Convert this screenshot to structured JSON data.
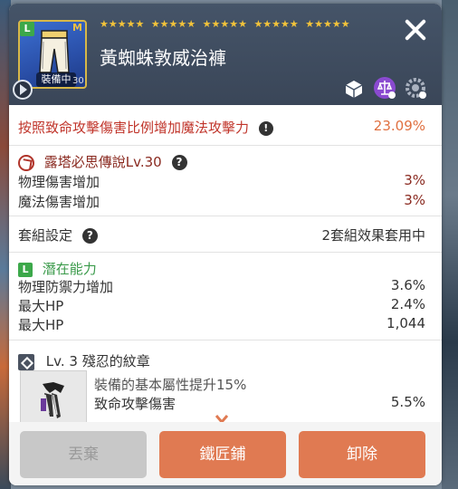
{
  "item": {
    "rank_badge": "L",
    "m_badge": "M",
    "equipped_label": "裝備中",
    "level": "30",
    "name": "黃蜘蛛敦威治褲",
    "star_groups": [
      "★★★★★",
      "★★★★★",
      "★★★★★",
      "★★★★★",
      "★★★★★"
    ]
  },
  "effect": {
    "label": "按照致命攻擊傷害比例增加魔法攻擊力",
    "value": "23.09%"
  },
  "set_item": {
    "title": "露塔必思傳說Lv.30",
    "stats": [
      {
        "label": "物理傷害增加",
        "value": "3%"
      },
      {
        "label": "魔法傷害增加",
        "value": "3%"
      }
    ]
  },
  "set_config": {
    "label": "套組設定",
    "value": "2套組效果套用中"
  },
  "potential": {
    "badge": "L",
    "title": "潛在能力",
    "stats": [
      {
        "label": "物理防禦力增加",
        "value": "3.6%"
      },
      {
        "label": "最大HP",
        "value": "2.4%"
      },
      {
        "label": "最大HP",
        "value": "1,044"
      }
    ]
  },
  "emblem": {
    "title": "Lv. 3 殘忍的紋章",
    "desc": "裝備的基本屬性提升15%",
    "stat_label": "致命攻擊傷害",
    "stat_value": "5.5%"
  },
  "buttons": {
    "discard": "丟棄",
    "blacksmith": "鐵匠鋪",
    "unequip": "卸除"
  },
  "colors": {
    "header_bg": "#455468",
    "accent_orange": "#e07a52",
    "effect_red": "#c0342a",
    "potential_green": "#3a9a4a"
  }
}
